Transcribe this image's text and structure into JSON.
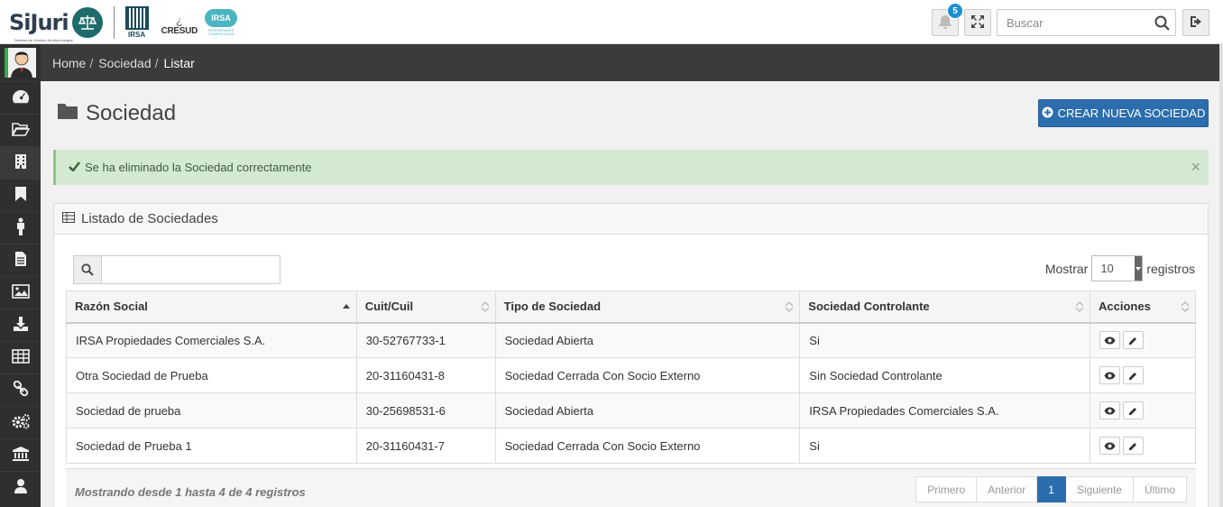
{
  "header": {
    "logo_text": "SiJuri",
    "logo_subtitle": "Sistema de Gestión Jurídica Integral",
    "brand_irsa": "IRSA",
    "brand_cresud": "CRESUD",
    "brand_irsa_pill": "IRSA",
    "brand_irsa_sub": "PROPIEDADES COMERCIALES",
    "notifications_count": "5",
    "search_placeholder": "Buscar"
  },
  "breadcrumb": {
    "items": [
      "Home",
      "Sociedad",
      "Listar"
    ]
  },
  "page": {
    "title": "Sociedad",
    "create_button": "CREAR NUEVA SOCIEDAD"
  },
  "alert": {
    "message": "Se ha eliminado la Sociedad correctamente",
    "close": "×"
  },
  "panel": {
    "title": "Listado de Sociedades",
    "show_label": "Mostrar",
    "show_value": "10",
    "records_label": "registros"
  },
  "table": {
    "columns": [
      "Razón Social",
      "Cuit/Cuil",
      "Tipo de Sociedad",
      "Sociedad Controlante",
      "Acciones"
    ],
    "rows": [
      [
        "IRSA Propiedades Comerciales S.A.",
        "30-52767733-1",
        "Sociedad Abierta",
        "Si"
      ],
      [
        "Otra Sociedad de Prueba",
        "20-31160431-8",
        "Sociedad Cerrada Con Socio Externo",
        "Sin Sociedad Controlante"
      ],
      [
        "Sociedad de prueba",
        "30-25698531-6",
        "Sociedad Abierta",
        "IRSA Propiedades Comerciales S.A."
      ],
      [
        "Sociedad de Prueba 1",
        "20-31160431-7",
        "Sociedad Cerrada Con Socio Externo",
        "Si"
      ]
    ]
  },
  "footer": {
    "info": "Mostrando desde 1 hasta 4 de 4 registros",
    "pager": [
      "Primero",
      "Anterior",
      "1",
      "Siguiente",
      "Último"
    ]
  },
  "sidebar_icons": [
    "dashboard-icon",
    "folder-icon",
    "building-icon",
    "bookmark-icon",
    "person-icon",
    "file-icon",
    "image-icon",
    "download-icon",
    "table-icon",
    "link-icon",
    "gears-icon",
    "bank-icon",
    "user-icon"
  ]
}
